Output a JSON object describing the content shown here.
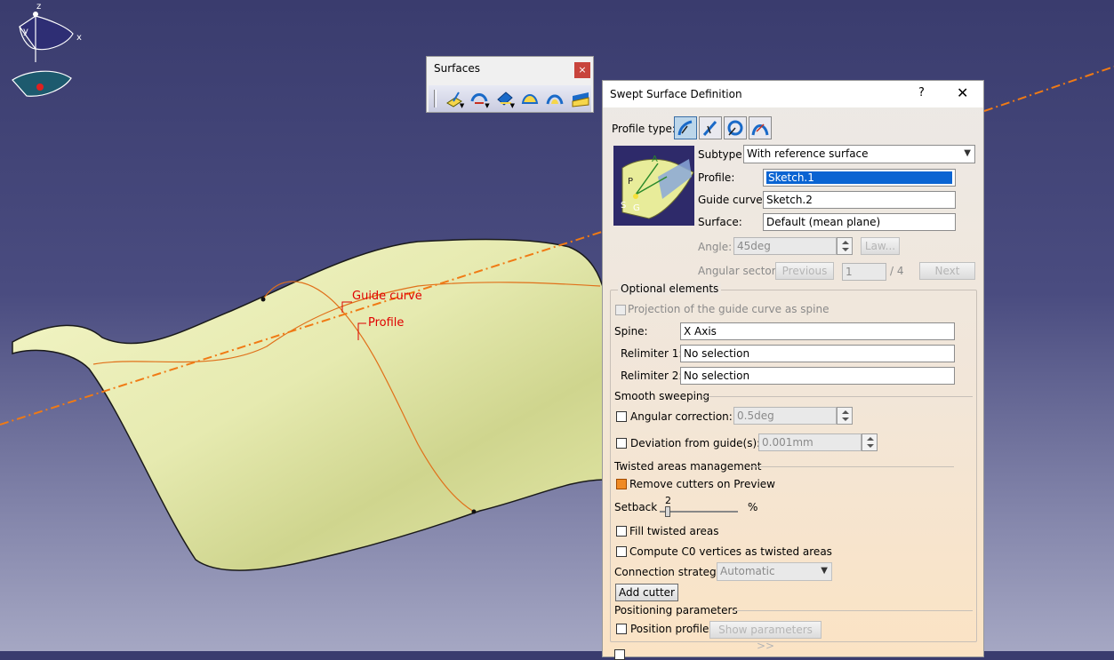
{
  "viewport": {
    "labels": {
      "guide_curve": "Guide curve",
      "profile": "Profile"
    },
    "compass": {
      "axis_x": "x",
      "axis_y": "y",
      "axis_z": "z"
    }
  },
  "toolbar": {
    "title": "Surfaces",
    "close": "×",
    "buttons": [
      "extrude-icon",
      "revolve-icon",
      "sweep-icon",
      "fill-icon",
      "multisection-icon",
      "blend-icon"
    ]
  },
  "dialog": {
    "title": "Swept Surface Definition",
    "help": "?",
    "close": "✕",
    "profile_type_label": "Profile type:",
    "profile_types": [
      "explicit-profile-icon",
      "line-profile-icon",
      "circle-profile-icon",
      "conic-profile-icon"
    ],
    "subtype_label": "Subtype:",
    "subtype_value": "With reference surface",
    "profile_label": "Profile:",
    "profile_value": "Sketch.1",
    "guide_curve_label": "Guide curve:",
    "guide_curve_value": "Sketch.2",
    "surface_label": "Surface:",
    "surface_value": "Default (mean plane)",
    "angle_label": "Angle:",
    "angle_value": "45deg",
    "law_button": "Law...",
    "angular_sector_label": "Angular sector:",
    "previous_button": "Previous",
    "sector_value": "1",
    "sector_total": "/ 4",
    "next_button": "Next",
    "preview_labels": {
      "a": "A",
      "p": "P",
      "s": "S",
      "g": "G"
    },
    "optional_elements": {
      "title": "Optional elements",
      "projection_label": "Projection of the guide curve as spine",
      "spine_label": "Spine:",
      "spine_value": "X Axis",
      "relimiter1_label": "Relimiter 1:",
      "relimiter1_value": "No selection",
      "relimiter2_label": "Relimiter 2:",
      "relimiter2_value": "No selection",
      "smooth_sweeping_title": "Smooth sweeping",
      "angular_correction_label": "Angular correction:",
      "angular_correction_value": "0.5deg",
      "deviation_label": "Deviation from guide(s):",
      "deviation_value": "0.001mm",
      "twisted_title": "Twisted areas management",
      "remove_cutters_label": "Remove cutters on Preview",
      "setback_label": "Setback",
      "setback_value": "2",
      "setback_unit": "%",
      "fill_twisted_label": "Fill twisted areas",
      "compute_c0_label": "Compute C0 vertices as twisted areas",
      "connection_strategy_label": "Connection strategy:",
      "connection_strategy_value": "Automatic",
      "add_cutter_button": "Add cutter",
      "positioning_title": "Positioning parameters",
      "position_profile_label": "Position profile",
      "show_parameters_button": "Show parameters >>"
    }
  }
}
